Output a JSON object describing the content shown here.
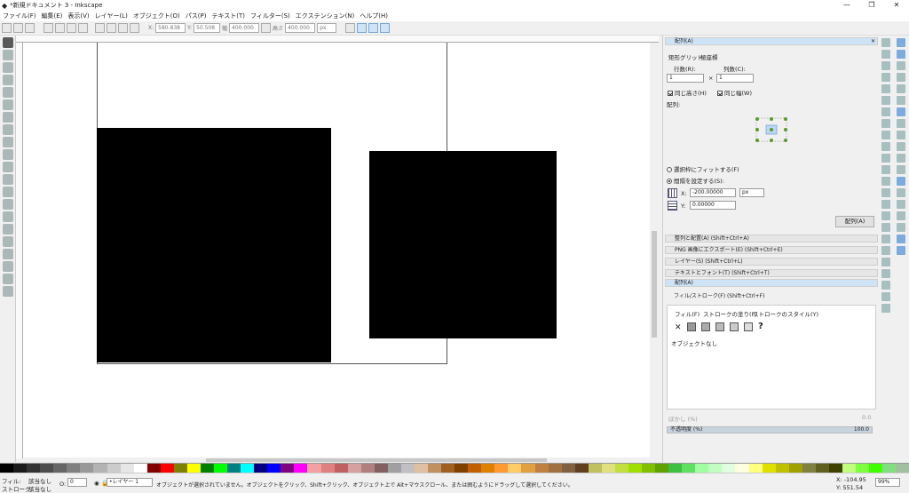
{
  "window": {
    "title": "*新規ドキュメント 3 - Inkscape",
    "minimize": "—",
    "maximize": "❐",
    "close": "✕"
  },
  "menu": [
    "ファイル(F)",
    "編集(E)",
    "表示(V)",
    "レイヤー(L)",
    "オブジェクト(O)",
    "パス(P)",
    "テキスト(T)",
    "フィルター(S)",
    "エクステンション(N)",
    "ヘルプ(H)"
  ],
  "toolctl": {
    "x_label": "X:",
    "x": "580.838",
    "y_label": "Y:",
    "y": "50.508",
    "w_label": "幅",
    "w": "400.000",
    "h_label": "高さ",
    "h": "400.000",
    "unit": "px"
  },
  "dock": {
    "array_panel_title": "配列(A)",
    "tabs": [
      "矩形グリッド",
      "極座標"
    ],
    "rows_label": "行数(R):",
    "rows": "1",
    "cols_label": "列数(C):",
    "cols": "1",
    "times": "×",
    "equal_height": "同じ高さ(H)",
    "equal_width": "同じ幅(W)",
    "align_label": "配列:",
    "fit_selection": "選択枠にフィットする(F)",
    "set_spacing": "間隔を設定する(S):",
    "x_label": "X:",
    "x": "-200.00000",
    "unit": "px",
    "y_label": "Y:",
    "y": "0.00000",
    "arrange_button": "配列(A)",
    "collapsed": [
      "整列と配置(A) (Shift+Ctrl+A)",
      "PNG 画像にエクスポート(E) (Shift+Ctrl+E)",
      "レイヤー(S) (Shift+Ctrl+L)",
      "テキストとフォント(T) (Shift+Ctrl+T)",
      "配列(A)"
    ],
    "fillstroke_title": "フィル/ストローク(F) (Shift+Ctrl+F)",
    "fs_tabs": [
      "フィル(F)",
      "ストロークの塗り(P)",
      "ストロークのスタイル(Y)"
    ],
    "no_object": "オブジェクトなし",
    "blur_label": "ぼかし (%)",
    "blur": "0.0",
    "opacity_label": "不透明度 (%)",
    "opacity": "100.0"
  },
  "status": {
    "fill_label": "フィル:",
    "stroke_label": "ストローク:",
    "fill_value": "該当なし",
    "stroke_value": "該当なし",
    "o_label": "O:",
    "o_value": "0",
    "layer": "•レイヤー 1",
    "message": "オブジェクトが選択されていません。オブジェクトをクリック、Shift+クリック、オブジェクト上で Alt+マウスクロール、または囲むようにドラッグして選択してください。",
    "x_coord": "X: -104.95",
    "y_coord": "Y: 551.54",
    "zoom": "99%"
  },
  "palette": [
    "#000000",
    "#1a1a1a",
    "#333333",
    "#4d4d4d",
    "#666666",
    "#808080",
    "#999999",
    "#b3b3b3",
    "#cccccc",
    "#e6e6e6",
    "#ffffff",
    "#800000",
    "#ff0000",
    "#808000",
    "#ffff00",
    "#008000",
    "#00ff00",
    "#008080",
    "#00ffff",
    "#000080",
    "#0000ff",
    "#800080",
    "#ff00ff",
    "#f4a0a0",
    "#e08080",
    "#c06060",
    "#d4a0a0",
    "#b08080",
    "#806060",
    "#a0a0a0",
    "#c0c0c0",
    "#e0c0a0",
    "#c09060",
    "#a06020",
    "#804000",
    "#c06000",
    "#e08000",
    "#ff9933",
    "#ffcc66",
    "#e0a040",
    "#c08040",
    "#a07040",
    "#806040",
    "#604020",
    "#c0c060",
    "#e0e080",
    "#c0e040",
    "#a0e000",
    "#80c000",
    "#60a000",
    "#40c040",
    "#60e060",
    "#a0ffa0",
    "#c0ffc0",
    "#e0ffe0",
    "#ffffe0",
    "#ffff80",
    "#e0e000",
    "#c0c000",
    "#a0a000",
    "#808040",
    "#606020",
    "#404000",
    "#c0ff80",
    "#80ff40",
    "#40ff00",
    "#80e080",
    "#a0c0a0"
  ]
}
